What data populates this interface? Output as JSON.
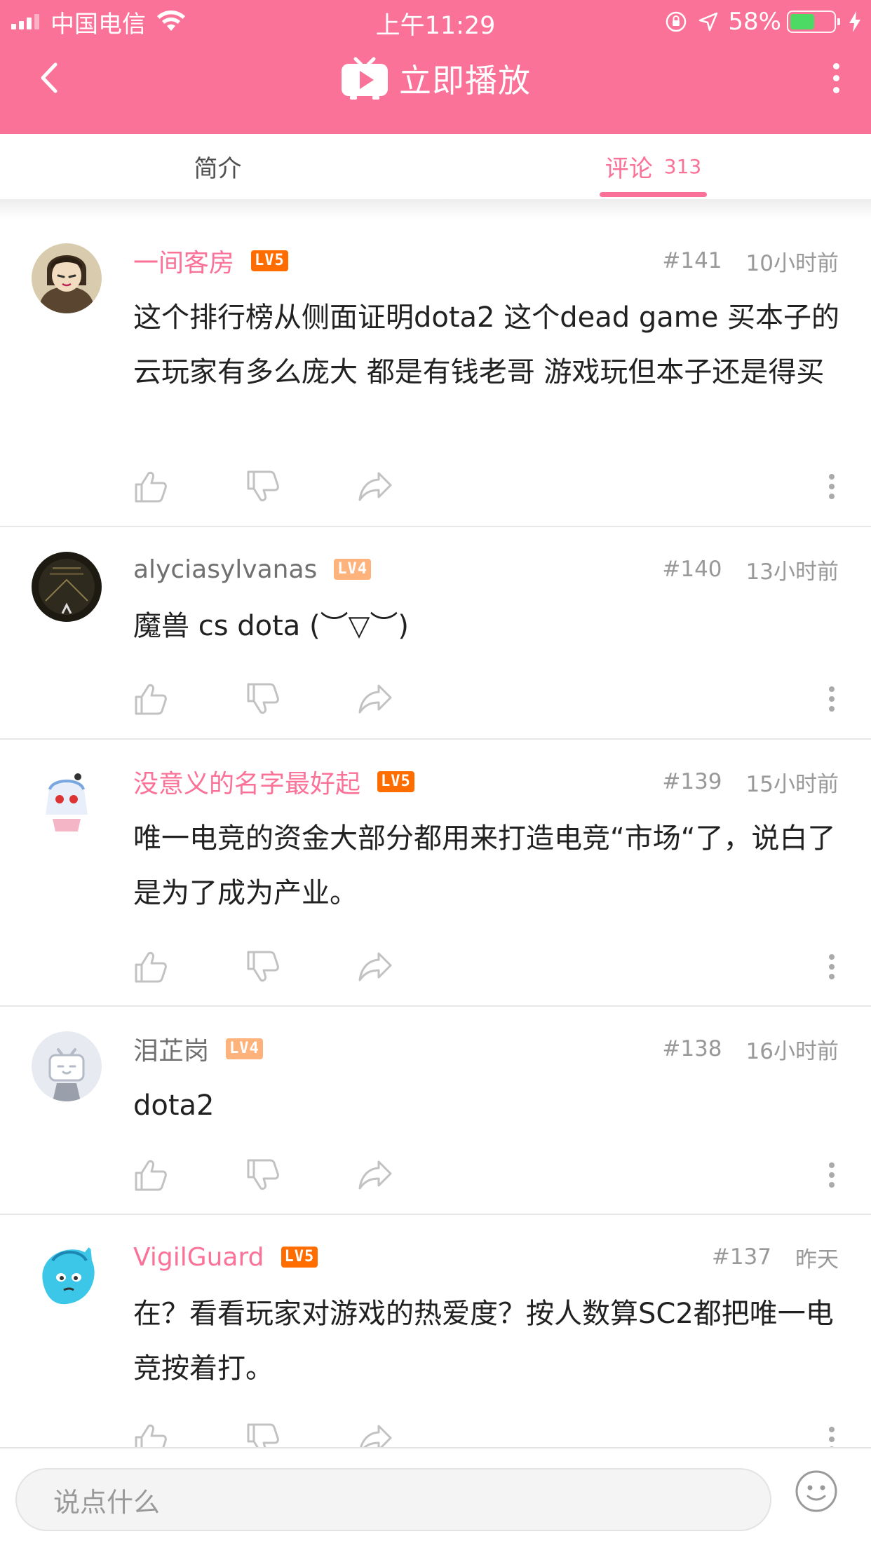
{
  "status_bar": {
    "carrier": "中国电信",
    "time": "上午11:29",
    "battery": "58%",
    "battery_level": 0.58,
    "icons": [
      "signal-icon",
      "wifi-icon",
      "orientation-lock-icon",
      "location-icon",
      "battery-icon",
      "charging-icon"
    ]
  },
  "nav": {
    "title": "立即播放",
    "icons": [
      "back-arrow-icon",
      "tv-play-icon",
      "more-vertical-icon"
    ]
  },
  "tabs": [
    {
      "label": "简介",
      "count": ""
    },
    {
      "label": "评论",
      "count": "313"
    }
  ],
  "active_tab": 1,
  "colors": {
    "accent": "#fb7299",
    "vip_name": "#fb7299",
    "normal_name": "#707070",
    "level_5": "#ff6c00",
    "level_4": "#ffb37c"
  },
  "comments": [
    {
      "user": "一间客房",
      "level": "LV5",
      "floor": "#141",
      "time": "10小时前",
      "content": "这个排行榜从侧面证明dota2 这个dead game 买本子的云玩家有多么庞大 都是有钱老哥 游戏玩但本子还是得买"
    },
    {
      "user": "alyciasylvanas",
      "level": "LV4",
      "floor": "#140",
      "time": "13小时前",
      "content": "魔兽 cs dota (︶▽︶)"
    },
    {
      "user": "没意义的名字最好起",
      "level": "LV5",
      "floor": "#139",
      "time": "15小时前",
      "content": "唯一电竞的资金大部分都用来打造电竞“市场“了，说白了是为了成为产业。"
    },
    {
      "user": "泪芷岗",
      "level": "LV4",
      "floor": "#138",
      "time": "16小时前",
      "content": "dota2"
    },
    {
      "user": "VigilGuard",
      "level": "LV5",
      "floor": "#137",
      "time": "昨天",
      "content": "在？看看玩家对游戏的热爱度？按人数算SC2都把唯一电竞按着打。"
    }
  ],
  "comment_actions": [
    "like-icon",
    "dislike-icon",
    "share-icon",
    "more-vertical-icon"
  ],
  "input": {
    "placeholder": "说点什么",
    "icon": "emoji-icon"
  }
}
